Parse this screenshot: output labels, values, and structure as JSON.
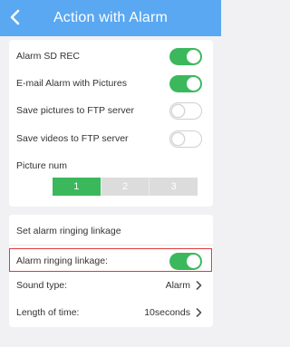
{
  "header": {
    "title": "Action with Alarm"
  },
  "alarm_settings": {
    "rows": [
      {
        "label": "Alarm SD REC",
        "on": true
      },
      {
        "label": "E-mail Alarm with Pictures",
        "on": true
      },
      {
        "label": "Save pictures to FTP server",
        "on": false
      },
      {
        "label": "Save videos to FTP server",
        "on": false
      }
    ],
    "picture_num_label": "Picture num",
    "picture_num_options": [
      "1",
      "2",
      "3"
    ],
    "picture_num_selected": "1"
  },
  "linkage": {
    "section_title": "Set alarm ringing linkage",
    "ringing_label": "Alarm ringing linkage:",
    "ringing_on": true,
    "sound_label": "Sound type:",
    "sound_value": "Alarm",
    "length_label": "Length of time:",
    "length_value": "10seconds"
  },
  "colors": {
    "header": "#5aa8f2",
    "toggle_on": "#3cb85c",
    "segment_active": "#3cb85c",
    "highlight": "#e03a3a"
  },
  "icons": {
    "back": "chevron-left-icon",
    "chevron": "chevron-right-icon"
  }
}
